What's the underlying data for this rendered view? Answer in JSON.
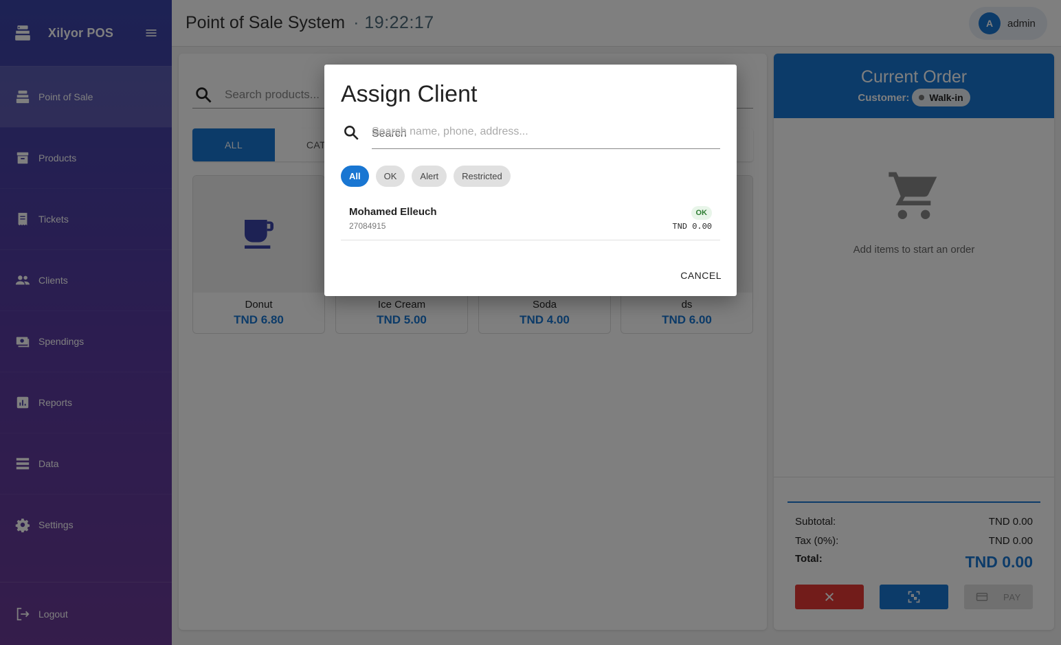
{
  "sidebar": {
    "brand": "Xilyor POS",
    "items": [
      {
        "label": "Point of Sale",
        "icon": "register-icon",
        "active": true
      },
      {
        "label": "Products",
        "icon": "archive-icon"
      },
      {
        "label": "Tickets",
        "icon": "receipt-icon"
      },
      {
        "label": "Clients",
        "icon": "people-icon"
      },
      {
        "label": "Spendings",
        "icon": "money-icon"
      },
      {
        "label": "Reports",
        "icon": "chart-icon"
      },
      {
        "label": "Data",
        "icon": "storage-icon"
      },
      {
        "label": "Settings",
        "icon": "gear-icon"
      }
    ],
    "logout": "Logout"
  },
  "header": {
    "title": "Point of Sale System",
    "separator": "·",
    "time": "19:22:17",
    "user": {
      "initial": "A",
      "name": "admin"
    }
  },
  "products": {
    "search_placeholder": "Search products...",
    "tabs": [
      "ALL",
      "CAT"
    ],
    "items": [
      {
        "name": "Donut",
        "price": "TND 6.80",
        "icon": "coffee-cup-icon"
      },
      {
        "name": "Ice Cream",
        "price": "TND 5.00"
      },
      {
        "name": "Soda",
        "price": "TND 4.00"
      },
      {
        "name": "ds",
        "price": "TND 6.00"
      }
    ]
  },
  "order": {
    "title": "Current Order",
    "customer_label": "Customer:",
    "customer_value": "Walk-in",
    "empty_text": "Add items to start an order",
    "subtotal_label": "Subtotal:",
    "subtotal": "TND 0.00",
    "tax_label": "Tax (0%):",
    "tax": "TND 0.00",
    "total_label": "Total:",
    "total": "TND 0.00",
    "pay_label": "PAY"
  },
  "dialog": {
    "title": "Assign Client",
    "search_label": "Search",
    "search_placeholder": "Search name, phone, address...",
    "filters": [
      "All",
      "OK",
      "Alert",
      "Restricted"
    ],
    "active_filter": "All",
    "clients": [
      {
        "name": "Mohamed Elleuch",
        "phone": "27084915",
        "status": "OK",
        "balance": "TND 0.00"
      }
    ],
    "cancel_label": "CANCEL"
  },
  "colors": {
    "primary": "#1976d2",
    "danger": "#e53935",
    "sidebar_top": "#3a44a8",
    "sidebar_bottom": "#6a3a96",
    "ok_bg": "#e8f5e9",
    "ok_text": "#2e7d32"
  }
}
